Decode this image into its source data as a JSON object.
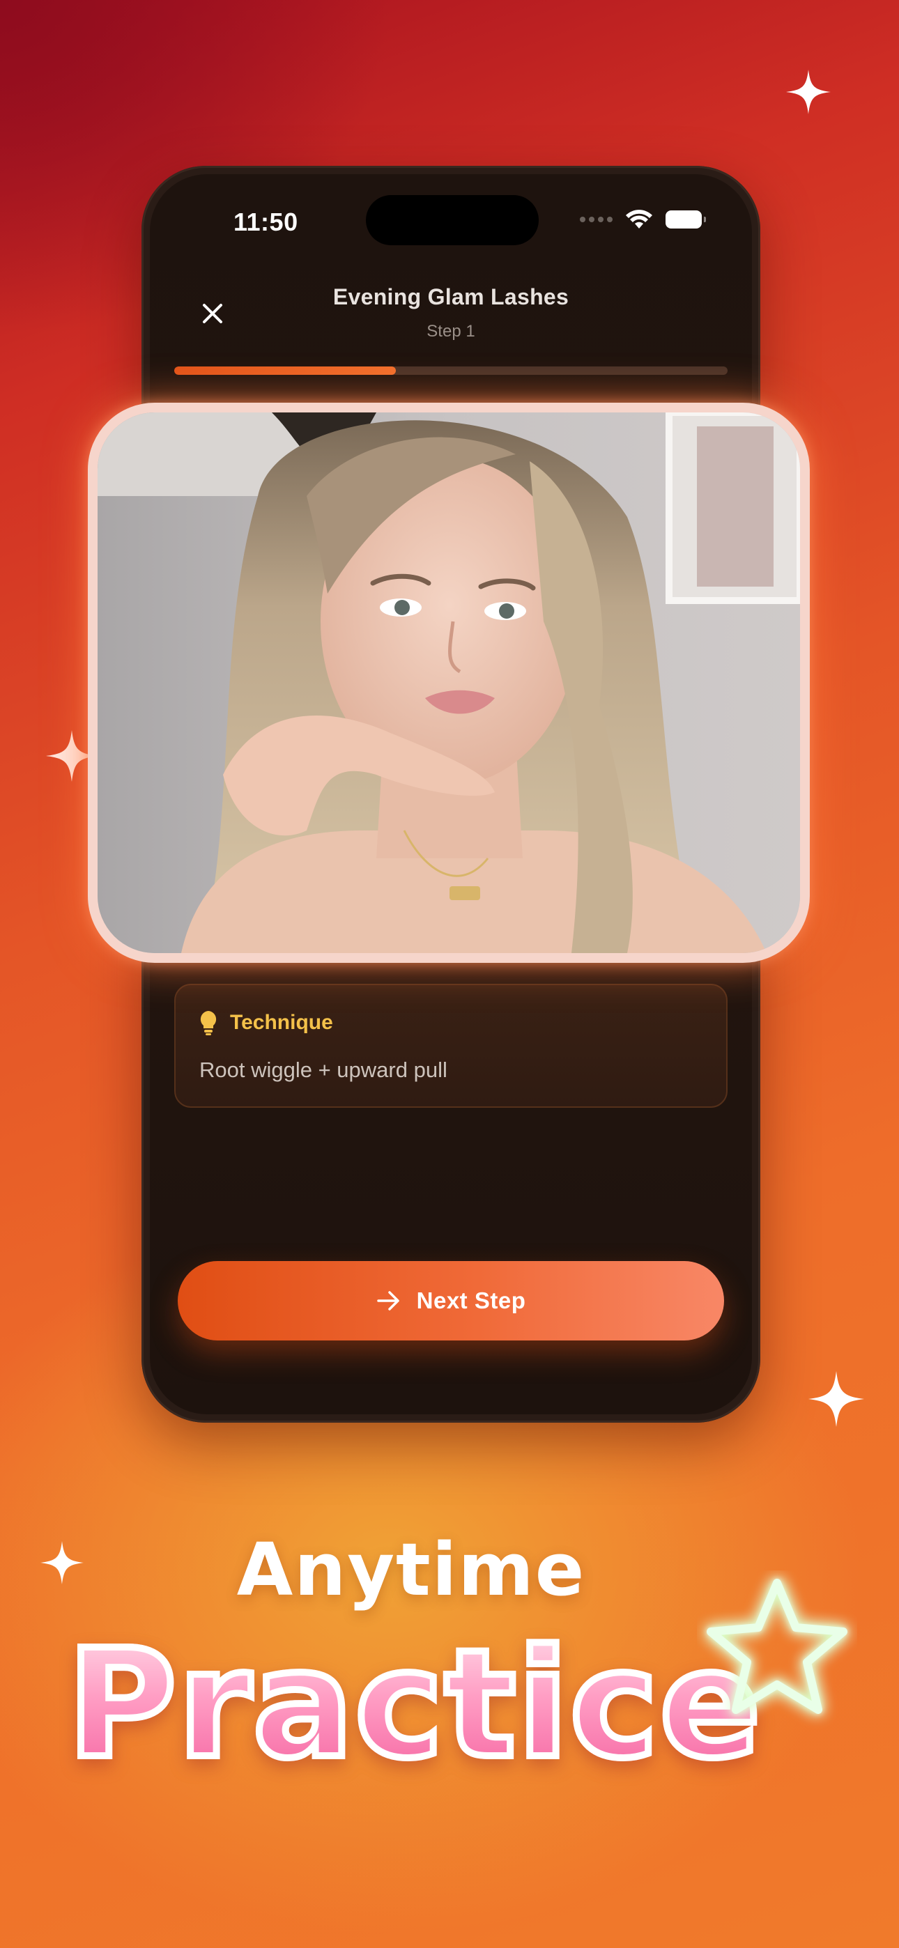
{
  "status_bar": {
    "time": "11:50"
  },
  "header": {
    "title": "Evening Glam Lashes",
    "step": "Step 1",
    "progress": 0.4
  },
  "tip": {
    "title": "Technique",
    "body": "Root wiggle + upward pull",
    "icon": "lightbulb-icon",
    "accent": "#f4c14a"
  },
  "cta": {
    "label": "Next Step",
    "icon": "arrow-right-icon"
  },
  "promo": {
    "line1": "Anytime",
    "line2": "Practice"
  },
  "colors": {
    "brand_orange": "#e45527",
    "button_start": "#e04e14",
    "button_end": "#f88766",
    "headline_pink": "#f46fa3"
  }
}
